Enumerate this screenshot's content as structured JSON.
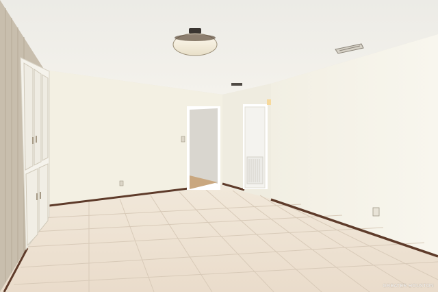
{
  "scene": {
    "description_label": "",
    "watermark_text": "GREATER HOUSTON",
    "colors": {
      "ceiling": "#f1efe8",
      "wall_left_back": "#f4f1e4",
      "wall_right": "#f6f3e8",
      "wall_left_panel": "#c9bfae",
      "floor_tile": "#efe4d6",
      "grout": "#d9ccbb",
      "baseboard": "#5e3b2a",
      "hallway": "#d9d6cf"
    },
    "elements": [
      "ceiling-light",
      "ceiling-vent",
      "built-in-cabinet",
      "doorway",
      "closet-door",
      "wall-outlet",
      "light-switch"
    ]
  }
}
